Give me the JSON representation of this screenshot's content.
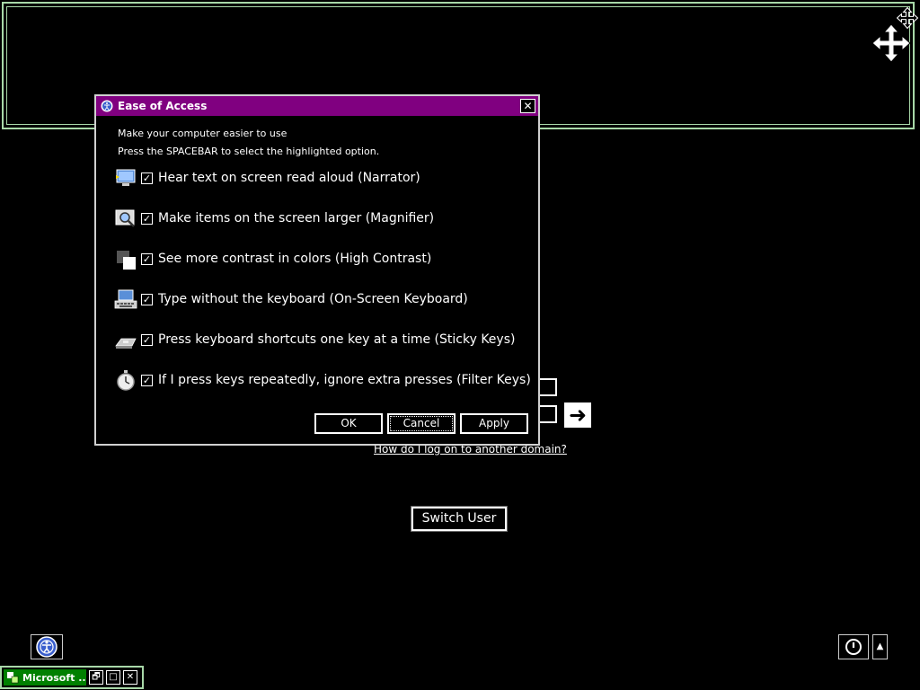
{
  "dialog": {
    "title": "Ease of Access",
    "intro_line1": "Make your computer easier to use",
    "intro_line2": "Press the SPACEBAR to select the highlighted option.",
    "options": [
      {
        "label": "Hear text on screen read aloud (Narrator)",
        "checked": true,
        "icon": "narrator-icon"
      },
      {
        "label": "Make items on the screen larger (Magnifier)",
        "checked": true,
        "icon": "magnifier-icon"
      },
      {
        "label": "See more contrast in colors (High Contrast)",
        "checked": true,
        "icon": "high-contrast-icon"
      },
      {
        "label": "Type without the keyboard (On-Screen Keyboard)",
        "checked": true,
        "icon": "on-screen-keyboard-icon"
      },
      {
        "label": "Press keyboard shortcuts one key at a time (Sticky Keys)",
        "checked": true,
        "icon": "sticky-keys-icon"
      },
      {
        "label": "If I press keys repeatedly, ignore extra presses (Filter Keys)",
        "checked": true,
        "icon": "filter-keys-icon"
      }
    ],
    "checkmark": "✓",
    "close_glyph": "✕",
    "buttons": {
      "ok": "OK",
      "cancel": "Cancel",
      "apply": "Apply"
    }
  },
  "logon": {
    "domain_link": "How do I log on to another domain?",
    "submit_arrow": "➜",
    "switch_user": "Switch User",
    "power_menu_arrow": "▲"
  },
  "taskbar": {
    "window_title": "Microsoft ...",
    "restore_glyph": "🗗",
    "maximize_glyph": "□",
    "close_glyph": "✕"
  },
  "colors": {
    "titlebar": "#800080",
    "panel_border": "#a8d8a8",
    "taskbar_title": "#008000"
  }
}
